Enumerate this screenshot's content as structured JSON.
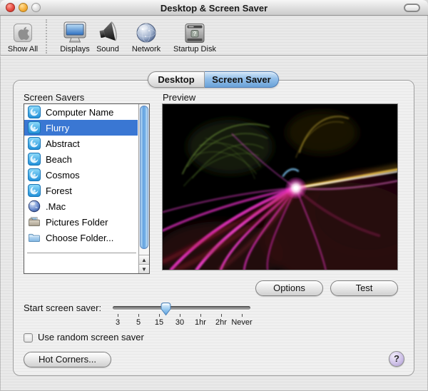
{
  "window": {
    "title": "Desktop & Screen Saver"
  },
  "titlebar": {
    "controls": [
      "close-button",
      "minimize-button",
      "zoom-button-disabled"
    ],
    "toolbar_toggle": "pill-button"
  },
  "toolbar": {
    "items": [
      {
        "label": "Show All",
        "icon": "apple-icon"
      },
      {
        "label": "Displays",
        "icon": "display-icon"
      },
      {
        "label": "Sound",
        "icon": "speaker-icon"
      },
      {
        "label": "Network",
        "icon": "globe-icon"
      },
      {
        "label": "Startup Disk",
        "icon": "startup-disk-icon"
      }
    ]
  },
  "tabs": {
    "desktop": "Desktop",
    "screen_saver": "Screen Saver",
    "selected": "Screen Saver"
  },
  "screen_savers": {
    "label": "Screen Savers",
    "selected": "Flurry",
    "items": [
      {
        "name": "Computer Name",
        "icon": "swirl-icon"
      },
      {
        "name": "Flurry",
        "icon": "swirl-icon"
      },
      {
        "name": "Abstract",
        "icon": "swirl-icon"
      },
      {
        "name": "Beach",
        "icon": "swirl-icon"
      },
      {
        "name": "Cosmos",
        "icon": "swirl-icon"
      },
      {
        "name": "Forest",
        "icon": "swirl-icon"
      },
      {
        "name": ".Mac",
        "icon": "mac-globe-icon"
      },
      {
        "name": "Pictures Folder",
        "icon": "pictures-folder-icon"
      },
      {
        "name": "Choose Folder...",
        "icon": "blue-folder-icon"
      }
    ]
  },
  "preview": {
    "label": "Preview",
    "showing": "Flurry screensaver preview"
  },
  "actions": {
    "options": "Options",
    "test": "Test",
    "hot_corners": "Hot Corners...",
    "help": "?"
  },
  "slider": {
    "label": "Start screen saver:",
    "tick_labels": [
      "3",
      "5",
      "15",
      "30",
      "1hr",
      "2hr",
      "Never"
    ],
    "thumb_position": "between 15 and 30"
  },
  "random_checkbox": {
    "label": "Use random screen saver",
    "checked": false
  },
  "colors": {
    "selection_blue": "#3a77d3",
    "selected_tab_blue": "#8fbce8",
    "scrollbar_aqua": "#5fa0e0",
    "help_purple": "#cfc2e8",
    "preview_background": "#000000"
  }
}
